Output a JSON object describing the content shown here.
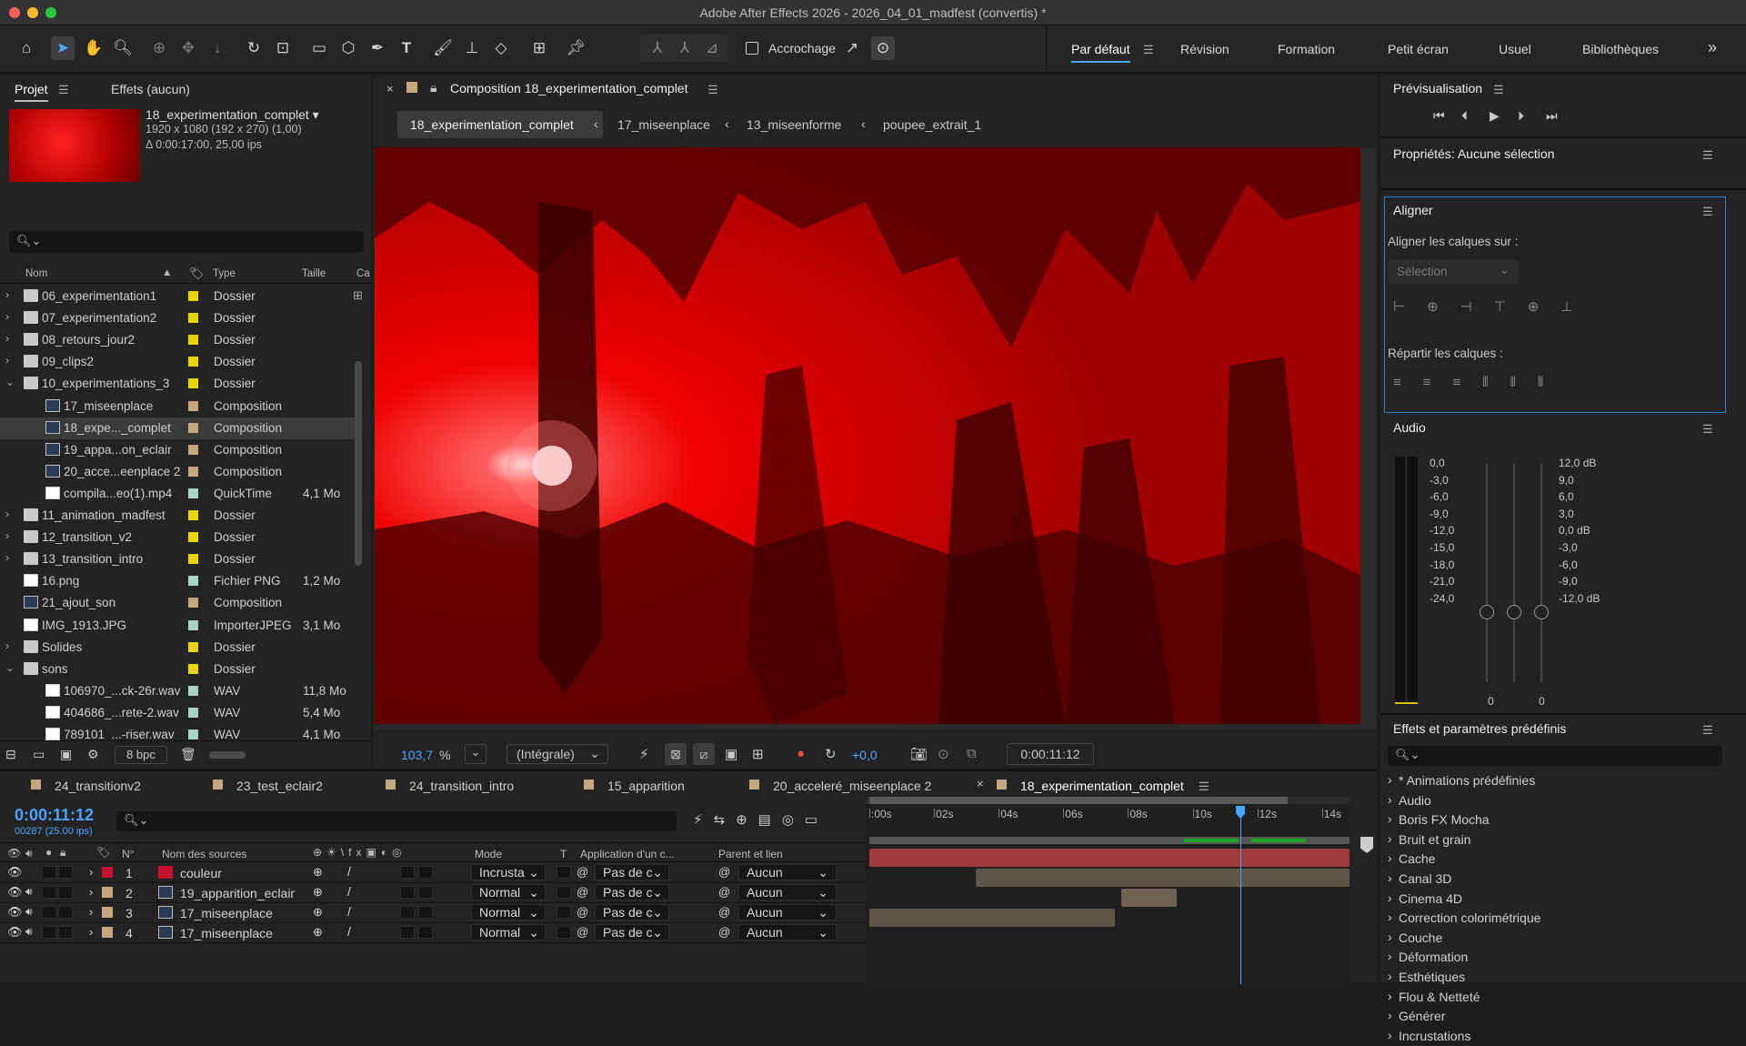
{
  "window": {
    "title": "Adobe After Effects 2026 - 2026_04_01_madfest (convertis) *"
  },
  "toolbar": {
    "snapping": "Accrochage",
    "workspaces": [
      "Par défaut",
      "Révision",
      "Formation",
      "Petit écran",
      "Usuel",
      "Bibliothèques"
    ],
    "overflow": "»"
  },
  "project": {
    "tab_project": "Projet",
    "tab_effects": "Effets (aucun)",
    "selected_name": "18_experimentation_complet ▾",
    "selected_info1": "1920 x 1080  (192 x 270) (1,00)",
    "selected_info2": "Δ 0:00:17:00, 25,00 ips",
    "col_name": "Nom",
    "col_type": "Type",
    "col_size": "Taille",
    "col_extra": "Ca",
    "bpc": "8 bpc",
    "rows": [
      {
        "name": "06_experimentation1",
        "type": "Dossier",
        "size": "",
        "icon": "folder",
        "label": "#e8d400",
        "indent": 0,
        "chev": "›"
      },
      {
        "name": "07_experimentation2",
        "type": "Dossier",
        "size": "",
        "icon": "folder",
        "label": "#e8d400",
        "indent": 0,
        "chev": "›"
      },
      {
        "name": "08_retours_jour2",
        "type": "Dossier",
        "size": "",
        "icon": "folder",
        "label": "#e8d400",
        "indent": 0,
        "chev": "›"
      },
      {
        "name": "09_clips2",
        "type": "Dossier",
        "size": "",
        "icon": "folder",
        "label": "#e8d400",
        "indent": 0,
        "chev": "›"
      },
      {
        "name": "10_experimentations_3",
        "type": "Dossier",
        "size": "",
        "icon": "folder",
        "label": "#e8d400",
        "indent": 0,
        "chev": "⌄"
      },
      {
        "name": "17_miseenplace",
        "type": "Composition",
        "size": "",
        "icon": "comp",
        "label": "#c4a77e",
        "indent": 1,
        "chev": ""
      },
      {
        "name": "18_expe..._complet",
        "type": "Composition",
        "size": "",
        "icon": "comp",
        "label": "#c4a77e",
        "indent": 1,
        "chev": "",
        "sel": true
      },
      {
        "name": "19_appa...on_eclair",
        "type": "Composition",
        "size": "",
        "icon": "comp",
        "label": "#c4a77e",
        "indent": 1,
        "chev": ""
      },
      {
        "name": "20_acce...eenplace 2",
        "type": "Composition",
        "size": "",
        "icon": "comp",
        "label": "#c4a77e",
        "indent": 1,
        "chev": ""
      },
      {
        "name": "compila...eo(1).mp4",
        "type": "QuickTime",
        "size": "4,1 Mo",
        "icon": "file",
        "label": "#a9d3c6",
        "indent": 1,
        "chev": ""
      },
      {
        "name": "11_animation_madfest",
        "type": "Dossier",
        "size": "",
        "icon": "folder",
        "label": "#e8d400",
        "indent": 0,
        "chev": "›"
      },
      {
        "name": "12_transition_v2",
        "type": "Dossier",
        "size": "",
        "icon": "folder",
        "label": "#e8d400",
        "indent": 0,
        "chev": "›"
      },
      {
        "name": "13_transition_intro",
        "type": "Dossier",
        "size": "",
        "icon": "folder",
        "label": "#e8d400",
        "indent": 0,
        "chev": "›"
      },
      {
        "name": "16.png",
        "type": "Fichier PNG",
        "size": "1,2 Mo",
        "icon": "file",
        "label": "#a9d3c6",
        "indent": 0,
        "chev": ""
      },
      {
        "name": "21_ajout_son",
        "type": "Composition",
        "size": "",
        "icon": "comp",
        "label": "#c4a77e",
        "indent": 0,
        "chev": ""
      },
      {
        "name": "IMG_1913.JPG",
        "type": "ImporterJPEG",
        "size": "3,1 Mo",
        "icon": "file",
        "label": "#a9d3c6",
        "indent": 0,
        "chev": ""
      },
      {
        "name": "Solides",
        "type": "Dossier",
        "size": "",
        "icon": "folder",
        "label": "#e8d400",
        "indent": 0,
        "chev": "›"
      },
      {
        "name": "sons",
        "type": "Dossier",
        "size": "",
        "icon": "folder",
        "label": "#e8d400",
        "indent": 0,
        "chev": "⌄"
      },
      {
        "name": "106970_...ck-26r.wav",
        "type": "WAV",
        "size": "11,8 Mo",
        "icon": "file",
        "label": "#a9d3c6",
        "indent": 1,
        "chev": ""
      },
      {
        "name": "404686_...rete-2.wav",
        "type": "WAV",
        "size": "5,4 Mo",
        "icon": "file",
        "label": "#a9d3c6",
        "indent": 1,
        "chev": ""
      },
      {
        "name": "789101_...-riser.wav",
        "type": "WAV",
        "size": "4,1 Mo",
        "icon": "file",
        "label": "#a9d3c6",
        "indent": 1,
        "chev": ""
      }
    ]
  },
  "composition": {
    "tab": "Composition 18_experimentation_complet",
    "breadcrumbs": [
      "18_experimentation_complet",
      "17_miseenplace",
      "13_miseenforme",
      "poupee_extrait_1"
    ],
    "zoom": "103,7",
    "zoom_unit": "%",
    "resolution": "(Intégrale)",
    "exposure": "+0,0",
    "timecode": "0:00:11:12"
  },
  "preview": {
    "title": "Prévisualisation"
  },
  "properties": {
    "title": "Propriétés: Aucune sélection"
  },
  "align": {
    "title": "Aligner",
    "align_to_label": "Aligner les calques sur :",
    "align_to_value": "Sélection",
    "distribute_label": "Répartir les calques :"
  },
  "audio": {
    "title": "Audio",
    "left_scale": [
      "0,0",
      "-3,0",
      "-6,0",
      "-9,0",
      "-12,0",
      "-15,0",
      "-18,0",
      "-21,0",
      "-24,0"
    ],
    "right_scale": [
      "12,0 dB",
      "9,0",
      "6,0",
      "3,0",
      "0,0 dB",
      "-3,0",
      "-6,0",
      "-9,0",
      "-12,0 dB"
    ],
    "zero_a": "0",
    "zero_b": "0"
  },
  "effects": {
    "title": "Effets et paramètres prédéfinis",
    "items": [
      "* Animations prédéfinies",
      "Audio",
      "Boris FX Mocha",
      "Bruit et grain",
      "Cache",
      "Canal 3D",
      "Cinema 4D",
      "Correction colorimétrique",
      "Couche",
      "Déformation",
      "Esthétiques",
      "Flou & Netteté",
      "Générer",
      "Incrustations"
    ]
  },
  "timeline": {
    "tabs": [
      "24_transitionv2",
      "23_test_eclair2",
      "24_transition_intro",
      "15_apparition",
      "20_acceleré_miseenplace 2",
      "18_experimentation_complet"
    ],
    "timecode": "0:00:11:12",
    "frames": "00287 (25.00 ips)",
    "headers": {
      "num": "N°",
      "source": "Nom des sources",
      "mode": "Mode",
      "t": "T",
      "app": "Application d'un c...",
      "parent": "Parent et lien"
    },
    "ruler": [
      ":00s",
      "02s",
      "04s",
      "06s",
      "08s",
      "10s",
      "12s",
      "14s"
    ],
    "playhead_sec": 11.48,
    "duration_sec": 15,
    "layers": [
      {
        "num": "1",
        "name": "couleur",
        "mode": "Incrusta",
        "app": "Pas de c",
        "parent": "Aucun",
        "color": "#c8102e",
        "icon": "solid",
        "bar_start": 0,
        "bar_end": 15,
        "bar_color": "#9e3a3a"
      },
      {
        "num": "2",
        "name": "19_apparition_eclair",
        "mode": "Normal",
        "app": "Pas de c",
        "parent": "Aucun",
        "color": "#c4a77e",
        "icon": "comp",
        "bar_start": 3.3,
        "bar_end": 15,
        "bar_color": "#5f5448"
      },
      {
        "num": "3",
        "name": "17_miseenplace",
        "mode": "Normal",
        "app": "Pas de c",
        "parent": "Aucun",
        "color": "#c4a77e",
        "icon": "comp",
        "bar_start": 7.8,
        "bar_end": 9.5,
        "bar_color": "#6f6252"
      },
      {
        "num": "4",
        "name": "17_miseenplace",
        "mode": "Normal",
        "app": "Pas de c",
        "parent": "Aucun",
        "color": "#c4a77e",
        "icon": "comp",
        "bar_start": 0,
        "bar_end": 7.6,
        "bar_color": "#5f5448"
      }
    ]
  }
}
